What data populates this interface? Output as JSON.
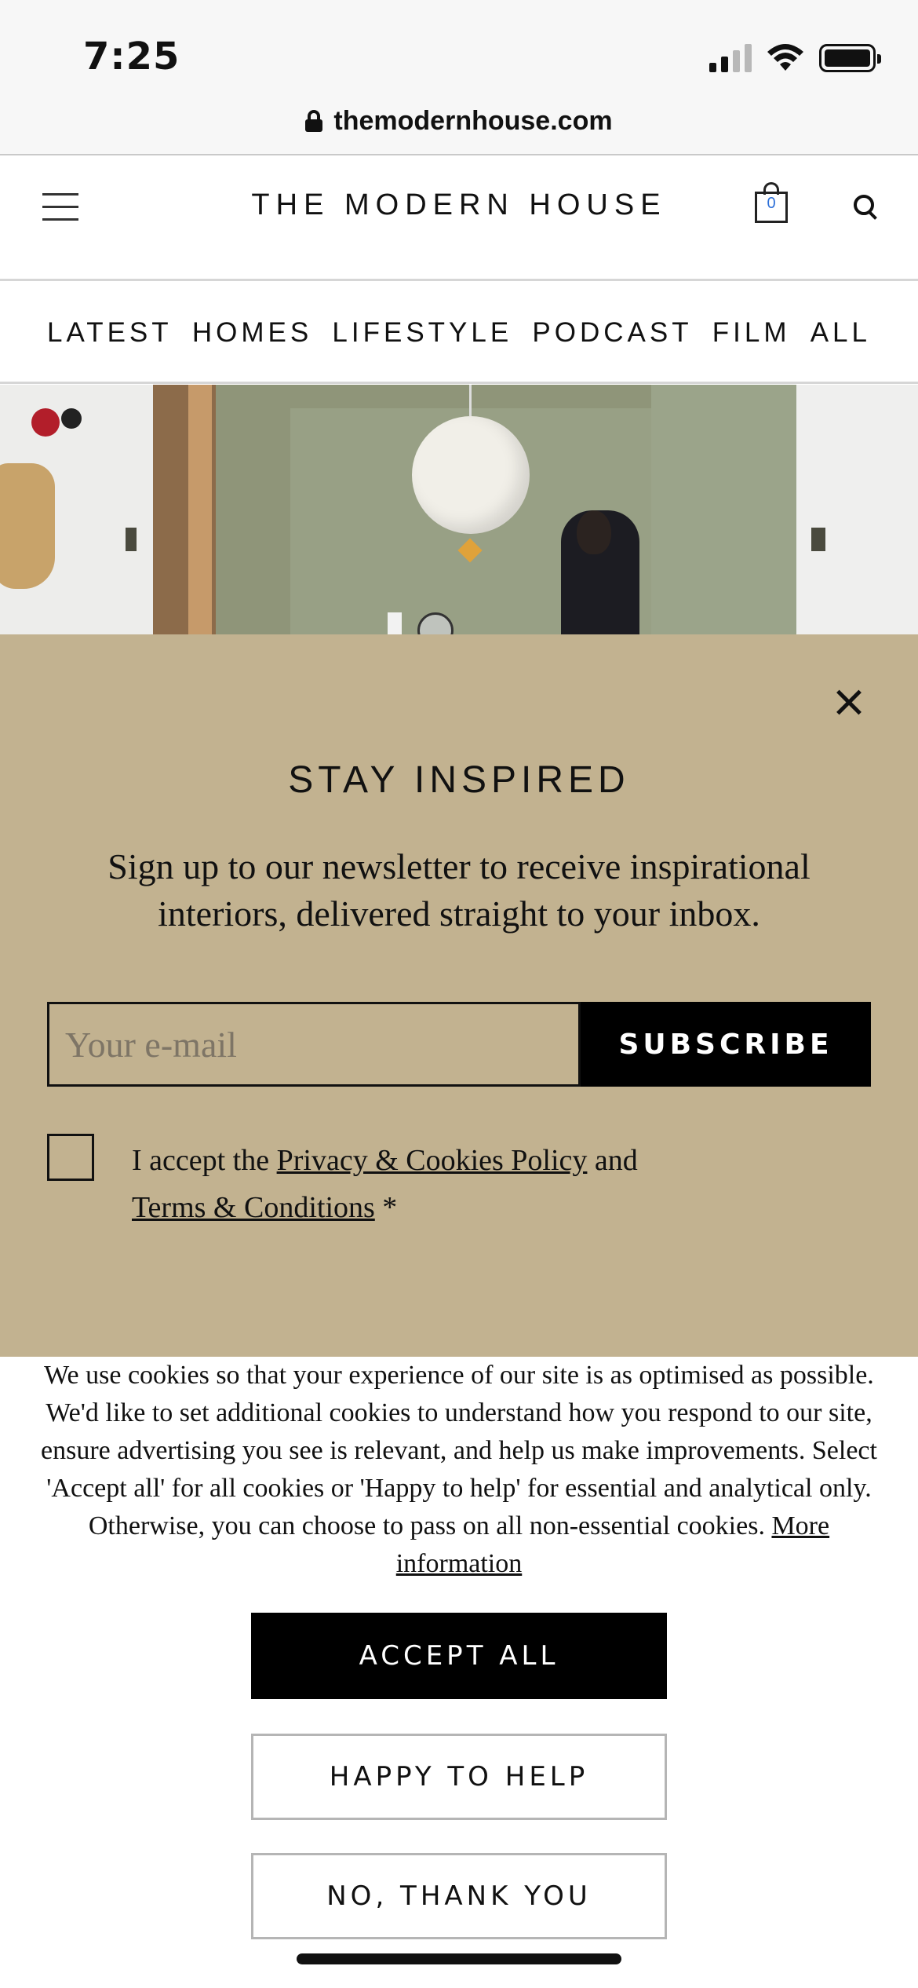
{
  "status_bar": {
    "time": "7:25",
    "signal_icon": "cellular-signal-icon",
    "wifi_icon": "wifi-icon",
    "battery_icon": "battery-icon"
  },
  "browser": {
    "url": "themodernhouse.com",
    "lock_icon": "lock-icon"
  },
  "header": {
    "menu_icon": "hamburger-menu-icon",
    "brand": "THE MODERN HOUSE",
    "cart_count": "0",
    "cart_icon": "shopping-bag-icon",
    "search_icon": "search-icon"
  },
  "nav": {
    "items": [
      "LATEST",
      "HOMES",
      "LIFESTYLE",
      "PODCAST",
      "FILM",
      "ALL"
    ]
  },
  "newsletter": {
    "title": "STAY INSPIRED",
    "text": "Sign up to our newsletter to receive inspirational interiors, delivered straight to your inbox.",
    "email_placeholder": "Your e-mail",
    "subscribe_label": "SUBSCRIBE",
    "consent_prefix": "I accept the ",
    "privacy_link": "Privacy & Cookies Policy",
    "consent_and": " and",
    "terms_link": "Terms & Conditions",
    "consent_suffix": " *",
    "background_color": "#c2b290"
  },
  "cookie": {
    "text": "We use cookies so that your experience of our site is as optimised as possible. We'd like to set additional cookies to understand how you respond to our site, ensure advertising you see is relevant, and help us make improvements. Select 'Accept all' for all cookies or 'Happy to help' for essential and analytical only. Otherwise, you can choose to pass on all non-essential cookies. ",
    "more_link": "More information",
    "accept_label": "ACCEPT ALL",
    "happy_label": "HAPPY TO HELP",
    "no_label": "NO, THANK YOU"
  }
}
